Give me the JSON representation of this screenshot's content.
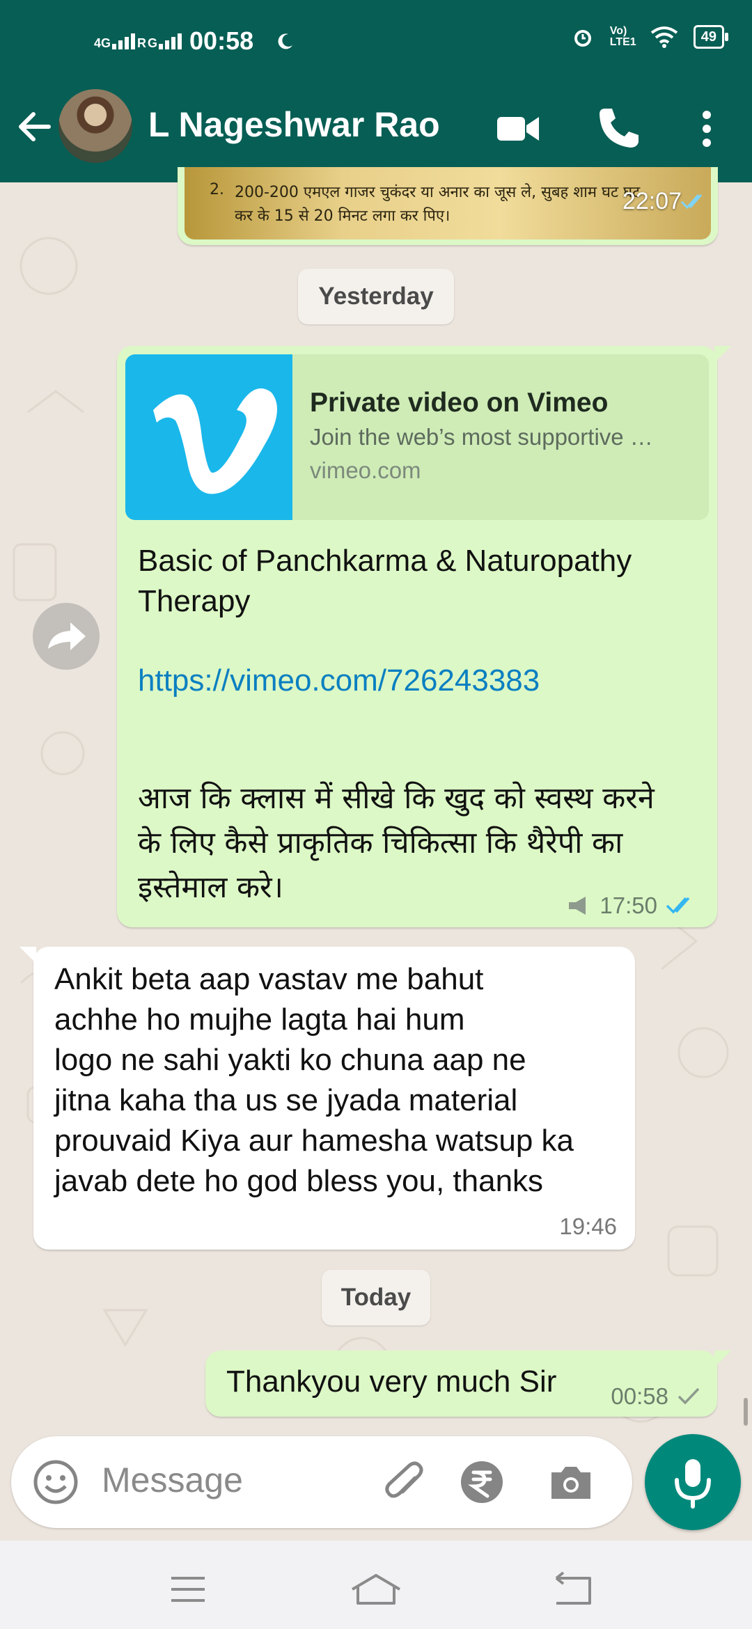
{
  "status_bar": {
    "network": "4G",
    "roaming": "R",
    "network2": "G",
    "time": "00:58",
    "volte": "Vo) LTE1",
    "battery": "49"
  },
  "header": {
    "contact_name": "L Nageshwar Rao",
    "icons": [
      "back-arrow-icon",
      "avatar",
      "video-call-icon",
      "voice-call-icon",
      "more-vert-icon"
    ]
  },
  "previous_message": {
    "line_number": "2.",
    "line1": "200-200 एमएल गाजर चुकंदर या अनार का जूस ले, सुबह शाम घट घट",
    "line2": "कर के 15 से 20 मिनट लगा कर पिए।",
    "time": "22:07"
  },
  "date_separators": {
    "yesterday": "Yesterday",
    "today": "Today"
  },
  "link_message": {
    "preview_title": "Private video on Vimeo",
    "preview_description": "Join the web’s most supportive …",
    "preview_domain": "vimeo.com",
    "text_line1": "Basic of Panchkarma & Naturopathy",
    "text_line2": "Therapy",
    "url": "https://vimeo.com/726243383",
    "hindi_line1": "आज कि क्लास में सीखे कि खुद को स्वस्थ करने",
    "hindi_line2": "के लिए कैसे प्राकृतिक चिकित्सा कि थैरेपी का",
    "hindi_line3": "इस्तेमाल करे।",
    "time": "17:50"
  },
  "incoming_message": {
    "lines": [
      "Ankit beta aap vastav me bahut",
      "achhe ho mujhe lagta hai hum",
      "logo ne sahi yakti ko chuna aap ne",
      "jitna kaha tha us se jyada material",
      "prouvaid Kiya aur hamesha watsup ka",
      "javab dete ho god bless you, thanks"
    ],
    "time": "19:46"
  },
  "outgoing_message": {
    "text": "Thankyou very much Sir",
    "time": "00:58"
  },
  "input": {
    "placeholder": "Message"
  },
  "colors": {
    "header": "#075e54",
    "outgoing_bubble": "#dcf8c6",
    "incoming_bubble": "#ffffff",
    "accent": "#00897b",
    "link": "#0a7fc1",
    "read_ticks": "#34b7f1",
    "vimeo": "#1ab7ea"
  }
}
